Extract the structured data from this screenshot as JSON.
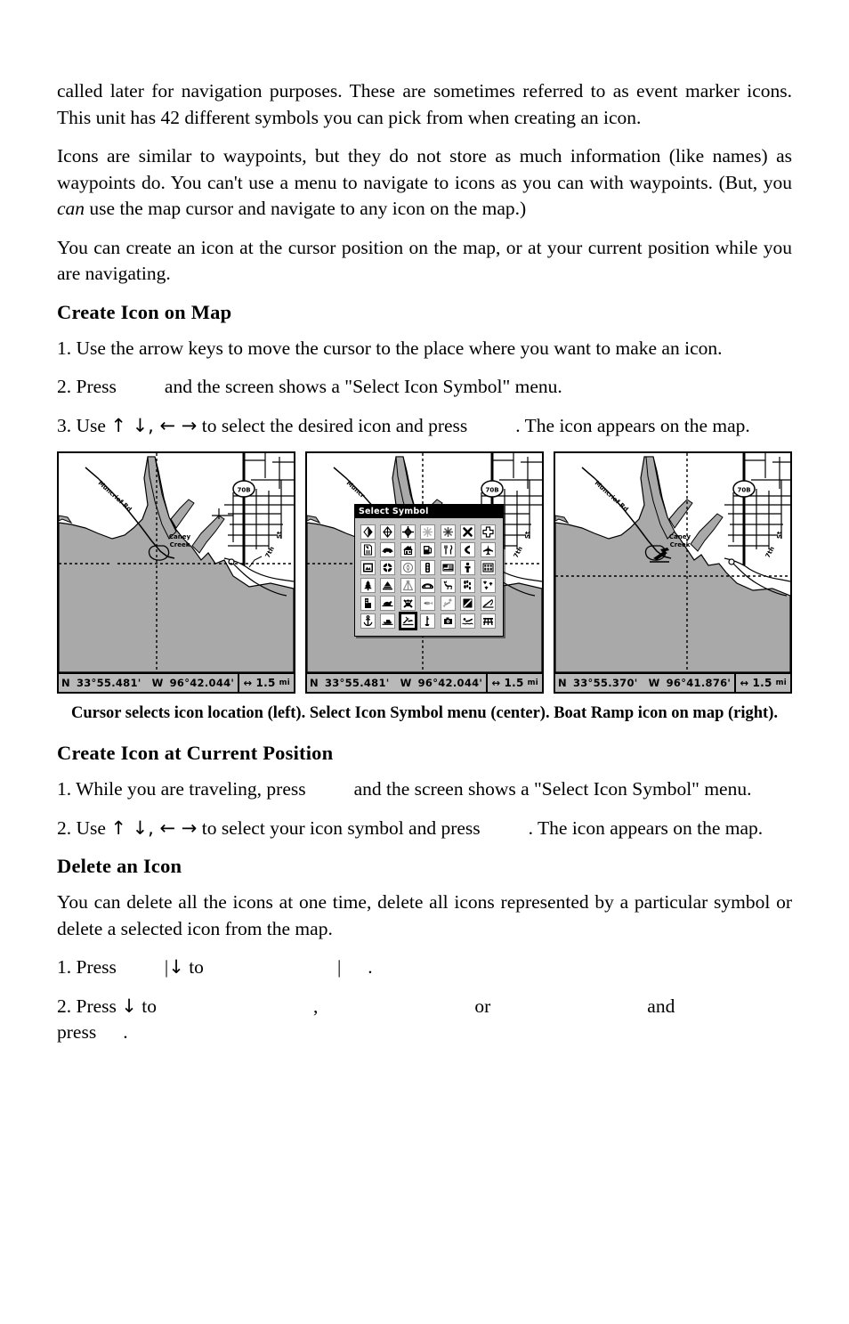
{
  "paragraphs": {
    "p1": "called later for navigation purposes. These are sometimes referred to as event marker icons. This unit has 42 different symbols you can pick from when creating an icon.",
    "p2_a": "Icons are similar to waypoints, but they do not store as much information (like names) as waypoints do. You can't use a menu to navigate to icons as you can with waypoints. (But, you ",
    "p2_ital": "can",
    "p2_b": " use the map cursor and navigate to any icon on the map.)",
    "p3": "You can create an icon at the cursor position on the map, or at your current position while you are navigating."
  },
  "headings": {
    "create_icon_on_map": "Create Icon on Map",
    "create_icon_at_current_position": "Create Icon at Current Position",
    "delete_an_icon": "Delete an Icon"
  },
  "steps_map": {
    "s1": "1. Use the arrow keys to move the cursor to the place where you want to make an icon.",
    "s2_a": "2. Press",
    "s2_b": "and the screen shows a \"Select Icon Symbol\" menu.",
    "s3_a": "3. Use",
    "s3_arrows": "↑ ↓, ← →",
    "s3_b": "to select the desired icon and press",
    "s3_c": ". The icon appears on the map."
  },
  "steps_current": {
    "s1_a": "1. While you are traveling, press",
    "s1_b": "and the screen shows a \"Select Icon Symbol\" menu.",
    "s2_a": "2. Use",
    "s2_arrows": "↑ ↓, ← →",
    "s2_b": "to select your icon symbol and press",
    "s2_c": ". The icon appears on the map."
  },
  "delete": {
    "intro": "You can delete all the icons at one time, delete all icons represented by a particular symbol or delete a selected icon from the map.",
    "s1_a": "1. Press",
    "s1_bar": "|",
    "s1_arrow": "↓",
    "s1_to": "to",
    "s1_bar2": "|",
    "s1_period": ".",
    "s2_a": "2. Press",
    "s2_arrow": "↓",
    "s2_to": "to",
    "s2_comma": ",",
    "s2_or": "or",
    "s2_and": "and",
    "s2_press": "press",
    "s2_period": "."
  },
  "caption": "Cursor selects icon location (left). Select Icon Symbol menu (center). Boat Ramp icon on map (right).",
  "figures": {
    "left": {
      "name": "cursor-selects-icon-location",
      "status": {
        "hemisphere_ns": "N",
        "latitude": "33°55.481'",
        "hemisphere_ew": "W",
        "longitude": "96°42.044'",
        "scale": "1.5",
        "scale_unit": "mi"
      },
      "map_labels": {
        "road": "Muncrief Rd",
        "creek": "Caney Creek",
        "highway_shield": "70B",
        "street_1": "St",
        "street_2": "7th"
      }
    },
    "center": {
      "name": "select-icon-symbol-menu",
      "status": {
        "hemisphere_ns": "N",
        "latitude": "33°55.481'",
        "hemisphere_ew": "W",
        "longitude": "96°42.044'",
        "scale": "1.5",
        "scale_unit": "mi"
      },
      "dialog_title": "Select Symbol",
      "selected_index": 37,
      "symbols": [
        "diamond-marker-icon",
        "diamond-outline-icon",
        "diamond-filled-icon",
        "asterisk-light-icon",
        "asterisk-icon",
        "x-mark-icon",
        "hospital-cross-icon",
        "document-icon",
        "car-icon",
        "house-icon",
        "fuel-pump-icon",
        "restaurant-icon",
        "telephone-icon",
        "airplane-icon",
        "photo-icon",
        "wheel-icon",
        "compass-icon",
        "traffic-light-icon",
        "flag-sign-icon",
        "person-icon",
        "building-grid-icon",
        "tree-icon",
        "tent-icon",
        "teepee-icon",
        "bridge-icon",
        "deer-icon",
        "animal-tracks-icon",
        "bird-tracks-icon",
        "tower-icon",
        "whale-icon",
        "skull-crossbones-icon",
        "fish-icon",
        "scuba-diver-icon",
        "no-entry-icon",
        "fishing-rod-icon",
        "anchor-icon",
        "boat-icon",
        "boat-ramp-icon",
        "buoy-icon",
        "camera-icon",
        "swimmer-icon",
        "picnic-table-icon"
      ],
      "map_labels": {
        "road": "Muncr",
        "highway_shield": "70B",
        "street_1": "St",
        "street_2": "7th"
      }
    },
    "right": {
      "name": "boat-ramp-icon-on-map",
      "status": {
        "hemisphere_ns": "N",
        "latitude": "33°55.370'",
        "hemisphere_ew": "W",
        "longitude": "96°41.876'",
        "scale": "1.5",
        "scale_unit": "mi"
      },
      "map_labels": {
        "road": "Muncrief Rd",
        "creek": "Caney Creek",
        "highway_shield": "70B",
        "street_1": "St",
        "street_2": "7th"
      }
    }
  },
  "colors": {
    "water_land_fill": "#a9a9a9",
    "status_bar": "#b9b9b9",
    "dialog_face": "#c6c6c6",
    "dialog_title_bg": "#000000",
    "paper": "#ffffff",
    "ink": "#000000"
  }
}
